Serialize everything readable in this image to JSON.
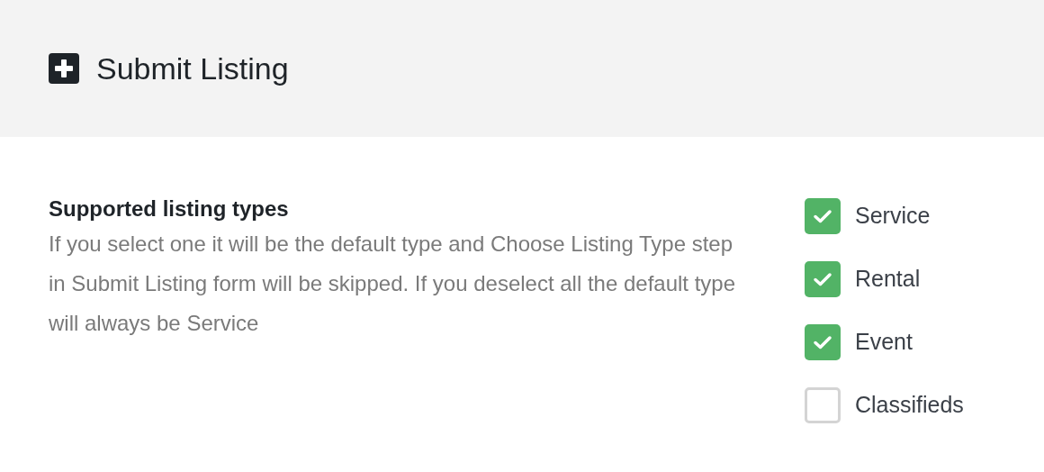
{
  "header": {
    "title": "Submit Listing"
  },
  "setting": {
    "title": "Supported listing types",
    "description": "If you select one it will be the default type and Choose Listing Type step in Submit Listing form will be skipped. If you deselect all the default type will always be Service"
  },
  "options": [
    {
      "label": "Service",
      "checked": true
    },
    {
      "label": "Rental",
      "checked": true
    },
    {
      "label": "Event",
      "checked": true
    },
    {
      "label": "Classifieds",
      "checked": false
    }
  ]
}
